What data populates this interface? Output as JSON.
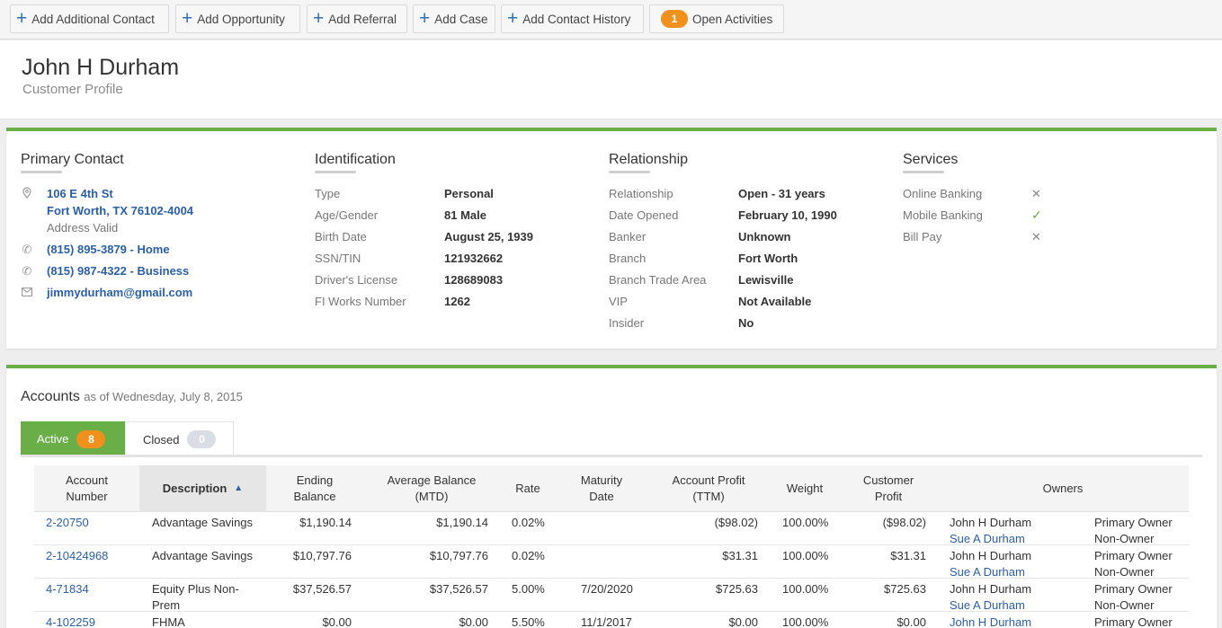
{
  "toolbar": {
    "add_additional_contact": "Add Additional Contact",
    "add_opportunity": "Add Opportunity",
    "add_referral": "Add Referral",
    "add_case": "Add Case",
    "add_contact_history": "Add Contact History",
    "open_activities_count": "1",
    "open_activities": "Open Activities"
  },
  "header": {
    "name": "John H Durham",
    "subtitle": "Customer Profile"
  },
  "primary_contact": {
    "title": "Primary Contact",
    "address_line1": "106 E 4th St",
    "address_line2": "Fort Worth, TX 76102-4004",
    "address_status": "Address Valid",
    "phone_home": "(815) 895-3879 - Home",
    "phone_business": "(815) 987-4322 - Business",
    "email": "jimmydurham@gmail.com"
  },
  "identification": {
    "title": "Identification",
    "items": [
      {
        "label": "Type",
        "value": "Personal"
      },
      {
        "label": "Age/Gender",
        "value": "81 Male"
      },
      {
        "label": "Birth Date",
        "value": "August 25, 1939"
      },
      {
        "label": "SSN/TIN",
        "value": "121932662"
      },
      {
        "label": "Driver's License",
        "value": "128689083"
      },
      {
        "label": "FI Works Number",
        "value": "1262"
      }
    ]
  },
  "relationship": {
    "title": "Relationship",
    "items": [
      {
        "label": "Relationship",
        "value": "Open - 31 years"
      },
      {
        "label": "Date Opened",
        "value": "February 10, 1990"
      },
      {
        "label": "Banker",
        "value": "Unknown"
      },
      {
        "label": "Branch",
        "value": "Fort Worth"
      },
      {
        "label": "Branch Trade Area",
        "value": "Lewisville"
      },
      {
        "label": "VIP",
        "value": "Not Available"
      },
      {
        "label": "Insider",
        "value": "No"
      }
    ]
  },
  "services": {
    "title": "Services",
    "items": [
      {
        "label": "Online Banking",
        "enabled": false,
        "mark": "✕"
      },
      {
        "label": "Mobile Banking",
        "enabled": true,
        "mark": "✓"
      },
      {
        "label": "Bill Pay",
        "enabled": false,
        "mark": "✕"
      }
    ]
  },
  "accounts": {
    "title": "Accounts",
    "as_of": "as of Wednesday, July 8, 2015",
    "tabs": [
      {
        "label": "Active",
        "count": "8"
      },
      {
        "label": "Closed",
        "count": "0"
      }
    ],
    "columns": {
      "account_number": [
        "Account",
        "Number"
      ],
      "description": "Description",
      "ending_balance": [
        "Ending",
        "Balance"
      ],
      "average_balance": [
        "Average Balance",
        "(MTD)"
      ],
      "rate": "Rate",
      "maturity_date": [
        "Maturity",
        "Date"
      ],
      "account_profit": [
        "Account Profit",
        "(TTM)"
      ],
      "weight": "Weight",
      "customer_profit": [
        "Customer",
        "Profit"
      ],
      "owners": "Owners"
    },
    "rows": [
      {
        "account": "2-20750",
        "description": [
          "Advantage Savings",
          ""
        ],
        "ending_balance": "$1,190.14",
        "average_balance": "$1,190.14",
        "rate": "0.02%",
        "maturity": "",
        "account_profit": "($98.02)",
        "weight": "100.00%",
        "customer_profit": "($98.02)",
        "owners": [
          {
            "name": "John H Durham",
            "role": "Primary Owner"
          },
          {
            "name": "Sue A Durham",
            "role": "Non-Owner"
          }
        ]
      },
      {
        "account": "2-10424968",
        "description": [
          "Advantage Savings",
          ""
        ],
        "ending_balance": "$10,797.76",
        "average_balance": "$10,797.76",
        "rate": "0.02%",
        "maturity": "",
        "account_profit": "$31.31",
        "weight": "100.00%",
        "customer_profit": "$31.31",
        "owners": [
          {
            "name": "John H Durham",
            "role": "Primary Owner"
          },
          {
            "name": "Sue A Durham",
            "role": "Non-Owner"
          }
        ]
      },
      {
        "account": "4-71834",
        "description": [
          "Equity Plus Non-",
          "Prem"
        ],
        "ending_balance": "$37,526.57",
        "average_balance": "$37,526.57",
        "rate": "5.00%",
        "maturity": "7/20/2020",
        "account_profit": "$725.63",
        "weight": "100.00%",
        "customer_profit": "$725.63",
        "owners": [
          {
            "name": "John H Durham",
            "role": "Primary Owner"
          },
          {
            "name": "Sue A Durham",
            "role": "Non-Owner"
          }
        ]
      },
      {
        "account": "4-102259",
        "description": [
          "FHMA",
          ""
        ],
        "ending_balance": "$0.00",
        "average_balance": "$0.00",
        "rate": "5.50%",
        "maturity": "11/1/2017",
        "account_profit": "$0.00",
        "weight": "100.00%",
        "customer_profit": "$0.00",
        "owners": [
          {
            "name": "John H Durham",
            "role": "Primary Owner"
          },
          {
            "name": "",
            "role": ""
          }
        ]
      }
    ]
  },
  "colors": {
    "accent_green": "#6aae47",
    "link_blue": "#2a5fa8",
    "badge_orange": "#f0901d"
  }
}
